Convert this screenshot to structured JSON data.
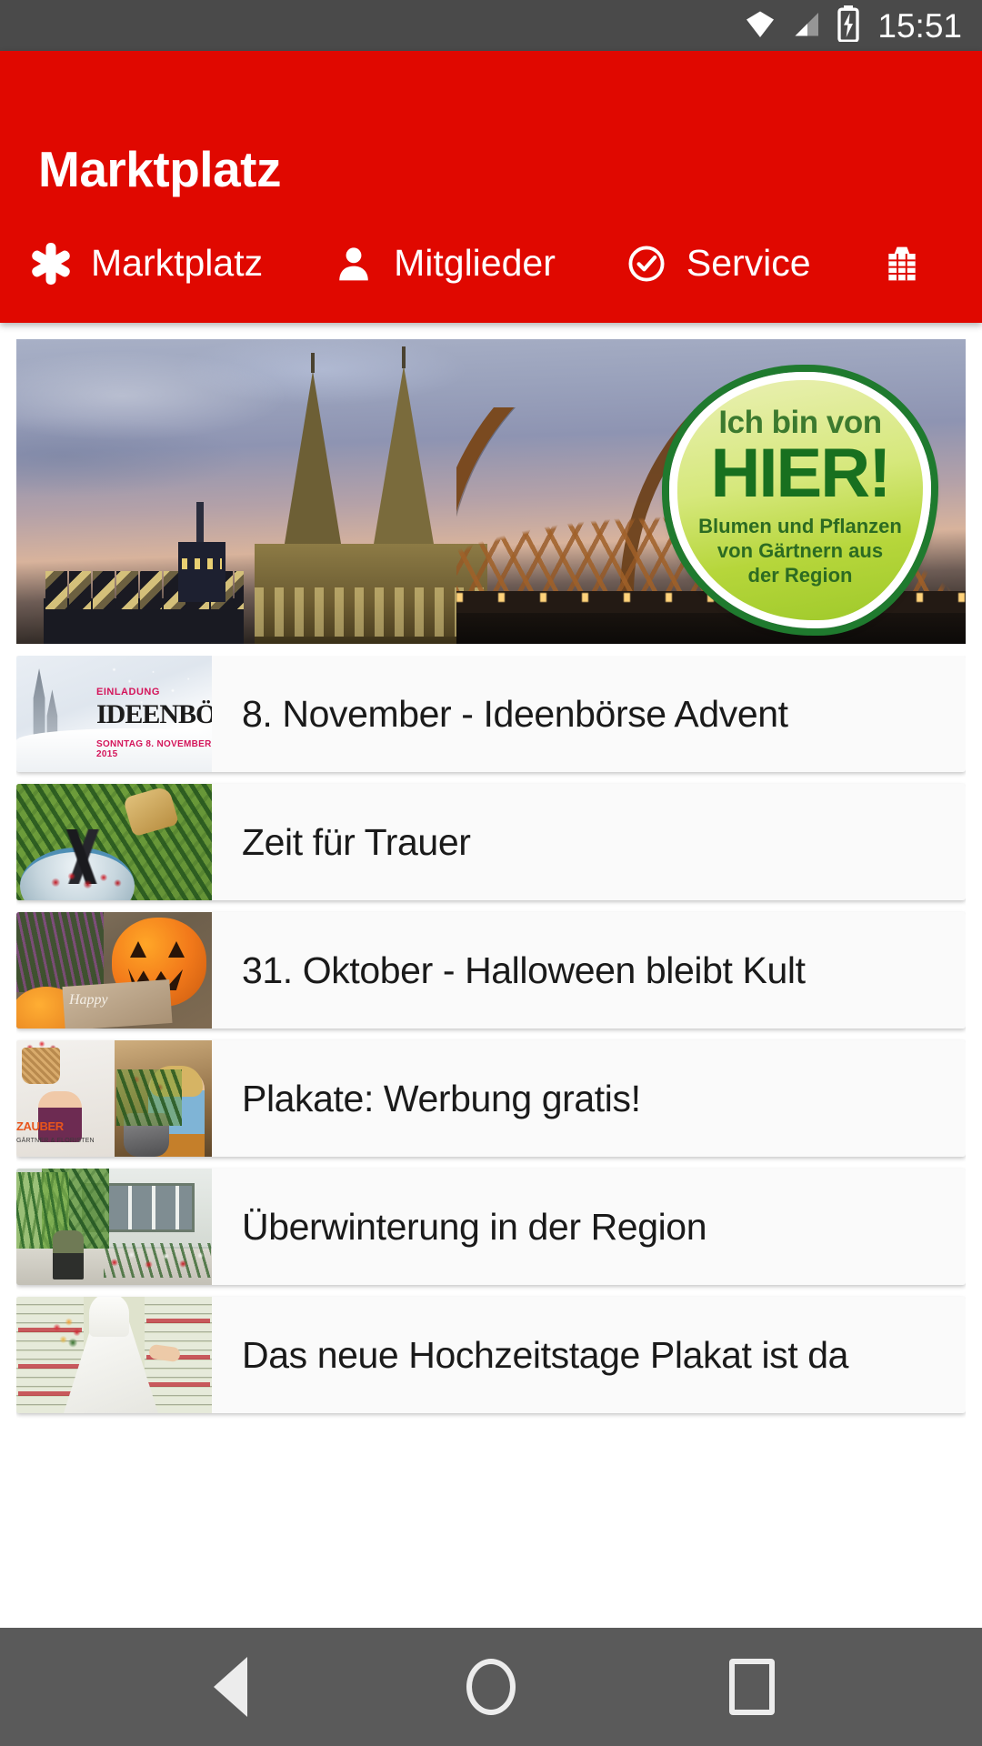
{
  "status_bar": {
    "time": "15:51",
    "icons": [
      "wifi-icon",
      "cell-signal-icon",
      "battery-charging-icon"
    ]
  },
  "app_bar": {
    "title": "Marktplatz",
    "background_color": "#e00800",
    "tabs": [
      {
        "label": "Marktplatz",
        "icon": "asterisk-flower-icon",
        "active": true
      },
      {
        "label": "Mitglieder",
        "icon": "person-icon",
        "active": false
      },
      {
        "label": "Service",
        "icon": "check-circle-icon",
        "active": false
      },
      {
        "label": "",
        "icon": "shop-building-icon",
        "active": false
      }
    ]
  },
  "hero": {
    "alt": "Cologne Cathedral and Hohenzollern Bridge at dusk",
    "badge": {
      "line1": "Ich bin von",
      "line2": "HIER!",
      "line3": "Blumen und Pflanzen\nvon Gärtnern aus\nder Region",
      "line3_a": "Blumen und Pflanzen",
      "line3_b": "von Gärtnern aus",
      "line3_c": "der Region",
      "color_green": "#1f7a2e",
      "color_light": "#d6e87c"
    }
  },
  "list": {
    "items": [
      {
        "title": "8. November - Ideenbörse Advent",
        "thumb": "ideenboerse-advent-thumb",
        "thumb_text": {
          "a": "EINLADUNG",
          "b": "IDEENBÖRSE",
          "c": "SONNTAG  8. NOVEMBER 2015"
        }
      },
      {
        "title": "Zeit für Trauer",
        "thumb": "trauer-wreath-thumb"
      },
      {
        "title": "31. Oktober - Halloween bleibt Kult",
        "thumb": "halloween-pumpkin-thumb",
        "thumb_text": {
          "a": "Happy"
        }
      },
      {
        "title": "Plakate: Werbung gratis!",
        "thumb": "plakate-werbung-thumb",
        "thumb_text": {
          "a": "ZAUBER",
          "b": "GÄRTNER & FLORISTEN"
        }
      },
      {
        "title": "Überwinterung in der Region",
        "thumb": "ueberwinterung-thumb"
      },
      {
        "title": "Das neue Hochzeitstage Plakat ist da",
        "thumb": "hochzeitstage-plakat-thumb"
      }
    ]
  },
  "nav_bar": {
    "buttons": [
      {
        "name": "back",
        "icon": "triangle-back-icon"
      },
      {
        "name": "home",
        "icon": "circle-home-icon"
      },
      {
        "name": "recents",
        "icon": "square-recents-icon"
      }
    ],
    "background_color": "#5a5a5a"
  }
}
